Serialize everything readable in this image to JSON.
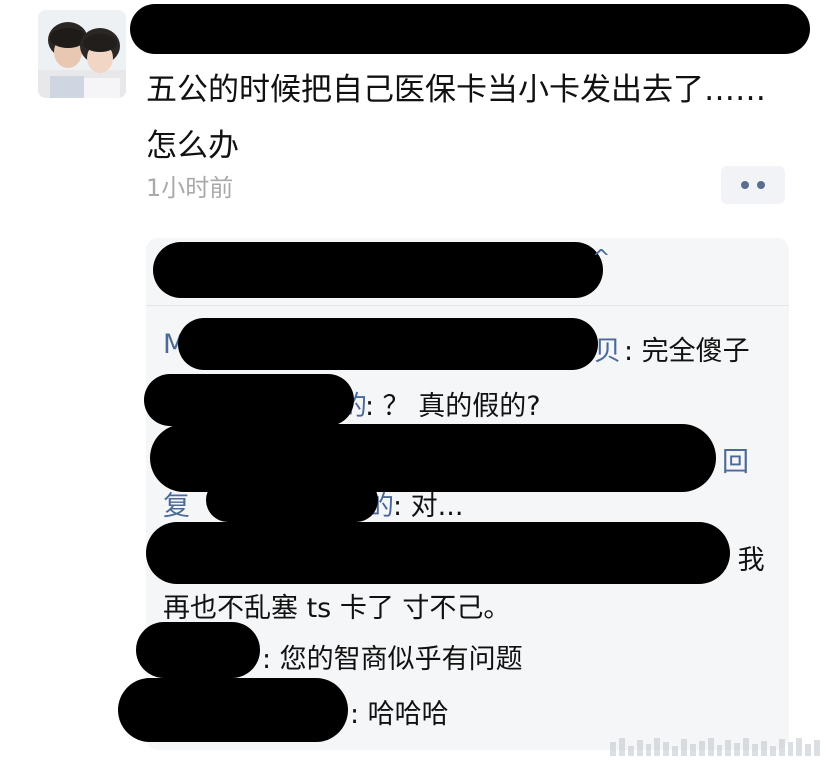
{
  "post": {
    "text": "五公的时候把自己医保卡当小卡发出去了……怎么办",
    "time": "1小时前",
    "more_icon": "more-dots-icon"
  },
  "comments": {
    "header_tail": "^",
    "lines": [
      {
        "prefix": "M",
        "mid": "贝",
        "text": ": 完全傻子"
      },
      {
        "prefix": "",
        "mid": "的",
        "text": ": ？ 真的假的?"
      },
      {
        "prefix": "",
        "mid": "",
        "text": "回"
      },
      {
        "prefix": "复",
        "mid": "的",
        "text": ": 对..."
      },
      {
        "prefix": "",
        "mid": "",
        "text": ": 我"
      },
      {
        "prefix": "",
        "mid": "",
        "text": "再也不乱塞 ts 卡了 寸不己。"
      },
      {
        "prefix": "",
        "mid": "",
        "text": ": 您的智商似乎有问题"
      },
      {
        "prefix": "",
        "mid": "",
        "text": ": 哈哈哈"
      }
    ]
  },
  "colors": {
    "username": "#4c6a99",
    "time": "#a9a9a9",
    "panel_bg": "#f5f6f8"
  }
}
